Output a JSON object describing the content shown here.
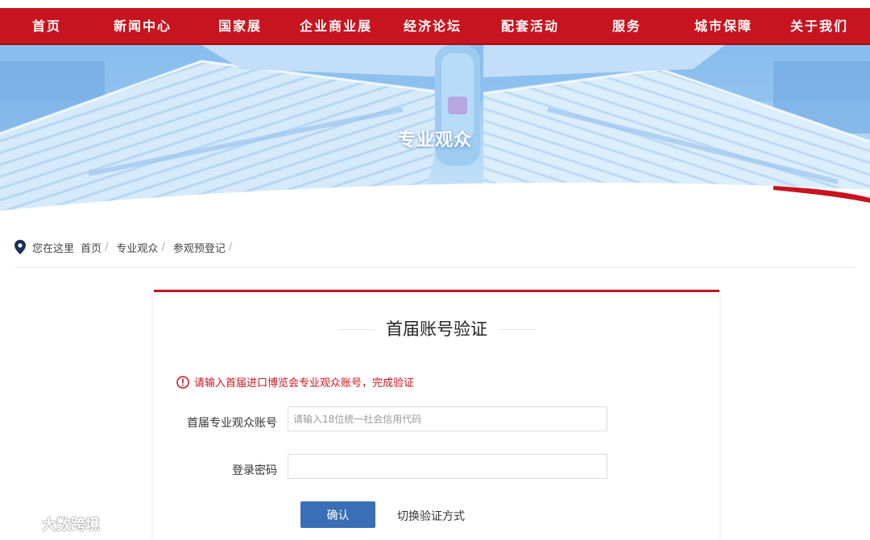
{
  "nav": {
    "items": [
      "首页",
      "新闻中心",
      "国家展",
      "企业商业展",
      "经济论坛",
      "配套活动",
      "服务",
      "城市保障",
      "关于我们"
    ]
  },
  "hero": {
    "title": "专业观众"
  },
  "breadcrumb": {
    "here_label": "您在这里",
    "items": [
      "首页",
      "专业观众",
      "参观预登记"
    ],
    "separator": "/"
  },
  "card": {
    "title": "首届账号验证",
    "notice": "请输入首届进口博览会专业观众账号，完成验证",
    "account_label": "首届专业观众账号",
    "account_placeholder": "请输入18位统一社会信用代码",
    "account_value": "",
    "password_label": "登录密码",
    "password_value": "",
    "confirm_label": "确认",
    "switch_label": "切换验证方式"
  },
  "watermark": {
    "text": "大数跨境"
  },
  "colors": {
    "brand_red": "#c8141e",
    "button_blue": "#3a6fb7",
    "hero_blue": "#a9d2f6"
  },
  "icons": {
    "breadcrumb": "location-pin-icon",
    "notice": "warning-circle-icon"
  }
}
